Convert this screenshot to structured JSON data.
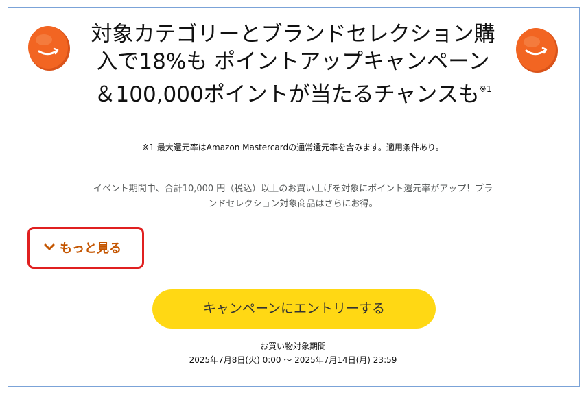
{
  "headline": {
    "text": "対象カテゴリーとブランドセレクション購入で18%も ポイントアップキャンペーン＆100,000ポイントが当たるチャンスも",
    "note_mark": "※1"
  },
  "footnote": "※1 最大還元率はAmazon Mastercardの通常還元率を含みます。適用条件あり。",
  "description": "イベント期間中、合計10,000 円（税込）以上のお買い上げを対象にポイント還元率がアップ！ブランドセレクション対象商品はさらにお得。",
  "more_button": {
    "label": "もっと見る",
    "icon": "chevron-down-icon"
  },
  "entry_button": {
    "label": "キャンペーンにエントリーする"
  },
  "period": {
    "label": "お買い物対象期間",
    "value": "2025年7月8日(火) 0:00 ～ 2025年7月14日(月) 23:59"
  },
  "colors": {
    "coin": "#f26522",
    "more_text": "#c45500",
    "highlight_border": "#e02020",
    "entry_button_bg": "#ffd814",
    "frame_border": "#7ba3d8"
  }
}
